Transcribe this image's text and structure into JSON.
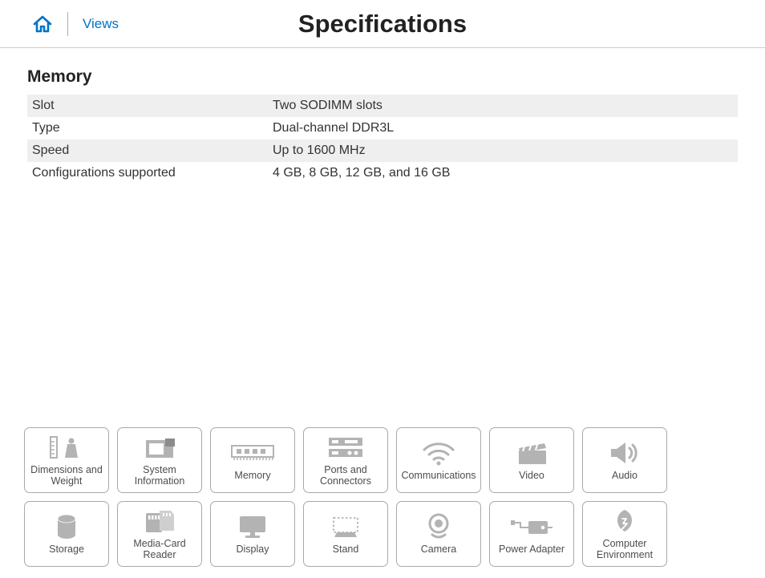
{
  "header": {
    "views_label": "Views",
    "page_title": "Specifications"
  },
  "section": {
    "title": "Memory",
    "rows": [
      {
        "label": "Slot",
        "value": "Two SODIMM slots"
      },
      {
        "label": "Type",
        "value": "Dual-channel DDR3L"
      },
      {
        "label": "Speed",
        "value": "Up to 1600 MHz"
      },
      {
        "label": "Configurations supported",
        "value": "4 GB, 8 GB, 12 GB, and 16 GB"
      }
    ]
  },
  "tiles": [
    {
      "id": "dimensions-and-weight",
      "label": "Dimensions and Weight",
      "icon": "ruler-weight"
    },
    {
      "id": "system-information",
      "label": "System Information",
      "icon": "chip"
    },
    {
      "id": "memory",
      "label": "Memory",
      "icon": "ram"
    },
    {
      "id": "ports-and-connectors",
      "label": "Ports and Connectors",
      "icon": "ports"
    },
    {
      "id": "communications",
      "label": "Communications",
      "icon": "wifi"
    },
    {
      "id": "video",
      "label": "Video",
      "icon": "clapper"
    },
    {
      "id": "audio",
      "label": "Audio",
      "icon": "speaker"
    },
    {
      "id": "storage",
      "label": "Storage",
      "icon": "cylinder"
    },
    {
      "id": "media-card-reader",
      "label": "Media-Card Reader",
      "icon": "sdcard"
    },
    {
      "id": "display",
      "label": "Display",
      "icon": "monitor"
    },
    {
      "id": "stand",
      "label": "Stand",
      "icon": "stand"
    },
    {
      "id": "camera",
      "label": "Camera",
      "icon": "webcam"
    },
    {
      "id": "power-adapter",
      "label": "Power Adapter",
      "icon": "adapter"
    },
    {
      "id": "computer-environment",
      "label": "Computer Environment",
      "icon": "leaf"
    }
  ]
}
